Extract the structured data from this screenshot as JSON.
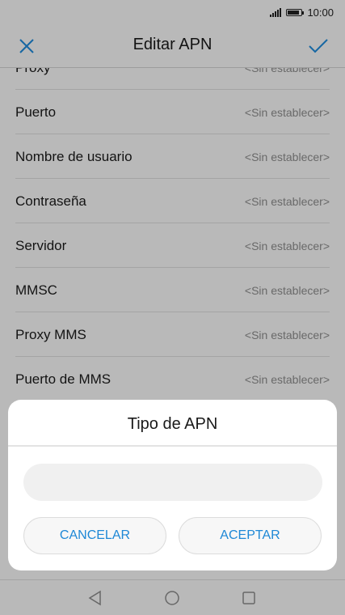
{
  "status_bar": {
    "time": "10:00",
    "icons": [
      "signal-icon",
      "battery-icon"
    ]
  },
  "app_bar": {
    "title": "Editar APN",
    "close_icon": "close-icon",
    "confirm_icon": "check-icon",
    "accent_color": "#1e88d6"
  },
  "list": {
    "items": [
      {
        "label": "Proxy",
        "value": "<Sin establecer>"
      },
      {
        "label": "Puerto",
        "value": "<Sin establecer>"
      },
      {
        "label": "Nombre de usuario",
        "value": "<Sin establecer>"
      },
      {
        "label": "Contraseña",
        "value": "<Sin establecer>"
      },
      {
        "label": "Servidor",
        "value": "<Sin establecer>"
      },
      {
        "label": "MMSC",
        "value": "<Sin establecer>"
      },
      {
        "label": "Proxy MMS",
        "value": "<Sin establecer>"
      },
      {
        "label": "Puerto de MMS",
        "value": "<Sin establecer>"
      }
    ]
  },
  "dialog": {
    "title": "Tipo de APN",
    "input_value": "",
    "cancel_label": "CANCELAR",
    "accept_label": "ACEPTAR"
  },
  "nav_bar": {
    "icons": [
      "back-icon",
      "home-icon",
      "recents-icon"
    ]
  }
}
